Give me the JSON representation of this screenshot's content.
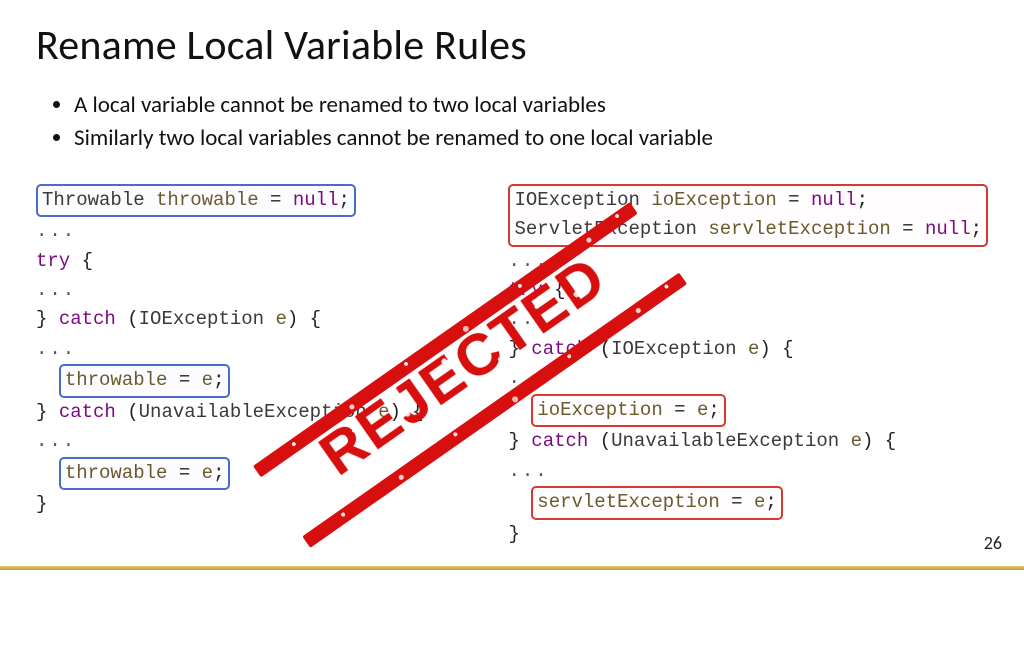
{
  "title": "Rename Local Variable Rules",
  "bullets": [
    "A local variable cannot be renamed to two local variables",
    "Similarly two local variables cannot be renamed to one local variable"
  ],
  "left_code": {
    "decl": {
      "type": "Throwable",
      "name": "throwable",
      "assign": "null"
    },
    "try": "try",
    "catch1": {
      "kw": "catch",
      "type": "IOException",
      "param": "e"
    },
    "assign1": {
      "lhs": "throwable",
      "rhs": "e"
    },
    "catch2": {
      "kw": "catch",
      "type": "UnavailableException",
      "param": "e"
    },
    "assign2": {
      "lhs": "throwable",
      "rhs": "e"
    }
  },
  "right_code": {
    "decl1": {
      "type": "IOException",
      "name": "ioException",
      "assign": "null"
    },
    "decl2": {
      "type": "ServletException",
      "name": "servletException",
      "assign": "null"
    },
    "try": "try",
    "catch1": {
      "kw": "catch",
      "type": "IOException",
      "param": "e"
    },
    "assign1": {
      "lhs": "ioException",
      "rhs": "e"
    },
    "catch2": {
      "kw": "catch",
      "type": "UnavailableException",
      "param": "e"
    },
    "assign2": {
      "lhs": "servletException",
      "rhs": "e"
    }
  },
  "stamp": "REJECTED",
  "page": "26"
}
